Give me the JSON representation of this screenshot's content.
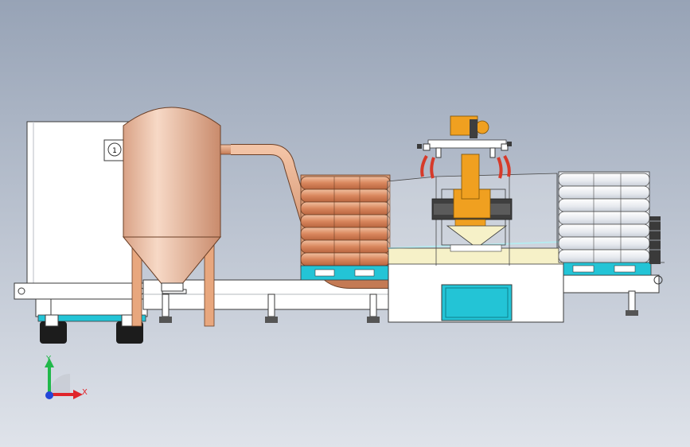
{
  "viewport": {
    "background_top": "#97a3b6",
    "background_bottom": "#dfe3ea"
  },
  "colors": {
    "copper": "#e8a77e",
    "copper_dark": "#b8714a",
    "tank": "#f2cdb5",
    "tank_shade": "#d9a286",
    "frame": "#ffffff",
    "outline": "#3a3a3a",
    "cyan": "#23c4d6",
    "robot": "#f0a020",
    "cream": "#f6f1c8",
    "wheel": "#1c1c1c",
    "axis_x": "#e0242a",
    "axis_y": "#21b84a",
    "axis_z": "#2346d8"
  },
  "triad": {
    "x_label": "X",
    "y_label": "Y"
  },
  "gauge": {
    "dial_label": "1"
  }
}
